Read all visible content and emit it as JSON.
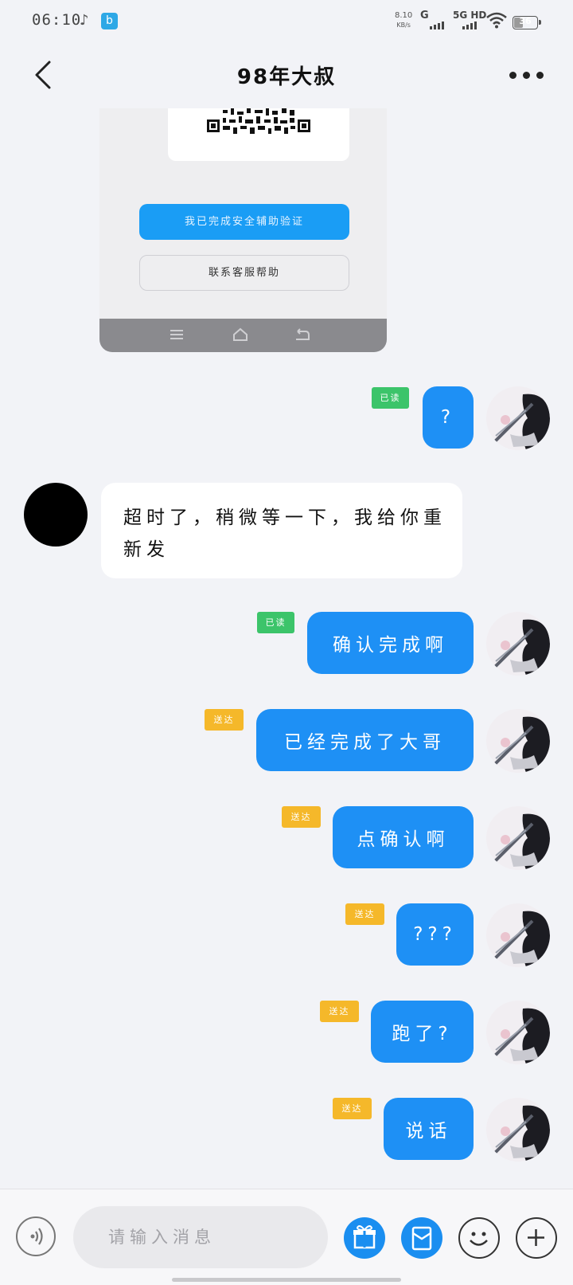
{
  "status_bar": {
    "time": "06:10",
    "net_speed_value": "8.10",
    "net_speed_unit": "KB/s",
    "network1": "G",
    "network2": "5G HD",
    "battery": "36"
  },
  "header": {
    "title": "98年大叔"
  },
  "shared_image": {
    "primary_button": "我已完成安全辅助验证",
    "secondary_button": "联系客服帮助"
  },
  "messages": [
    {
      "from": "me",
      "text": "?",
      "status": "已读"
    },
    {
      "from": "other",
      "text": "超时了，稍微等一下，我给你重新发"
    },
    {
      "from": "me",
      "text": "确认完成啊",
      "status": "已读"
    },
    {
      "from": "me",
      "text": "已经完成了大哥",
      "status": "送达"
    },
    {
      "from": "me",
      "text": "点确认啊",
      "status": "送达"
    },
    {
      "from": "me",
      "text": "???",
      "status": "送达"
    },
    {
      "from": "me",
      "text": "跑了?",
      "status": "送达"
    },
    {
      "from": "me",
      "text": "说话",
      "status": "送达"
    }
  ],
  "input": {
    "placeholder": "请输入消息"
  },
  "colors": {
    "bubble_out": "#1e90f5",
    "badge_read": "#3cc46a",
    "badge_sent": "#f5b82a"
  }
}
